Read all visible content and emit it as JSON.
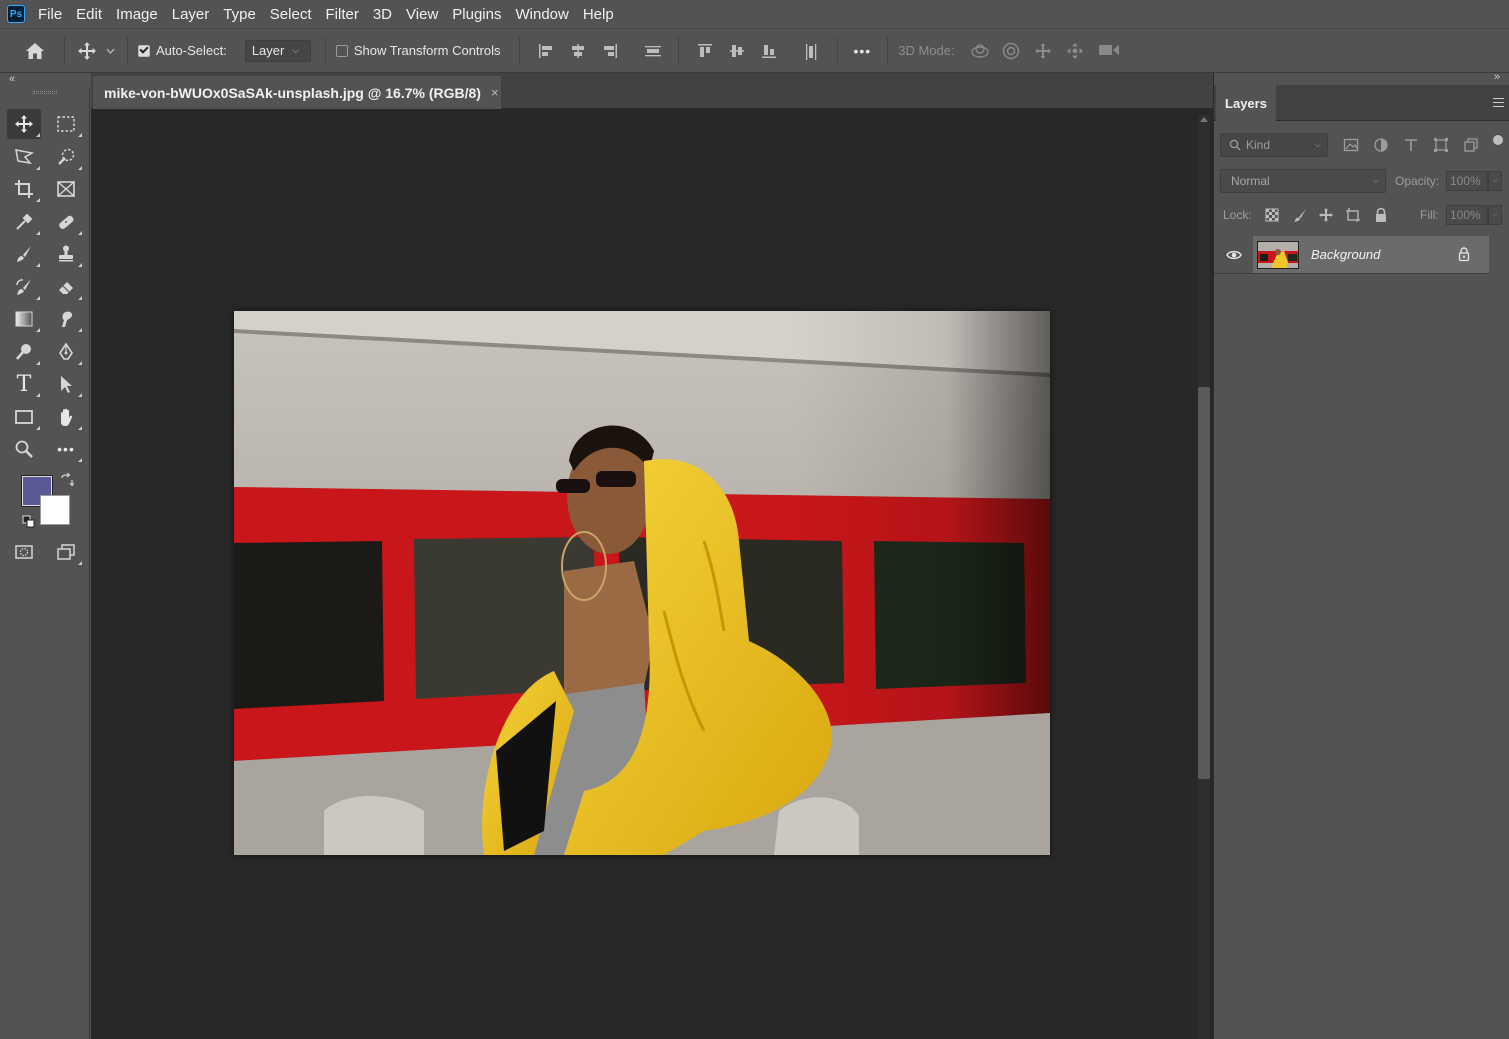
{
  "app": {
    "logo": "Ps",
    "menu": [
      "File",
      "Edit",
      "Image",
      "Layer",
      "Type",
      "Select",
      "Filter",
      "3D",
      "View",
      "Plugins",
      "Window",
      "Help"
    ]
  },
  "options_bar": {
    "auto_select_label": "Auto-Select:",
    "auto_select_checked": true,
    "auto_select_target": "Layer",
    "show_transform_label": "Show Transform Controls",
    "show_transform_checked": false,
    "more_label": "•••",
    "threed_mode_label": "3D Mode:"
  },
  "document": {
    "tab_title": "mike-von-bWUOx0SaSAk-unsplash.jpg @ 16.7% (RGB/8)",
    "close_glyph": "×"
  },
  "colors": {
    "foreground": "#5b5896",
    "background": "#ffffff",
    "accent": "#31a8ff"
  },
  "tools": {
    "more_glyph": "•••",
    "type_glyph": "T"
  },
  "layers_panel": {
    "tab_label": "Layers",
    "kind_placeholder": "Kind",
    "blend_mode": "Normal",
    "opacity_label": "Opacity:",
    "opacity_value": "100%",
    "lock_label": "Lock:",
    "fill_label": "Fill:",
    "fill_value": "100%",
    "layers": [
      {
        "name": "Background",
        "visible": true,
        "locked": true
      }
    ]
  },
  "collapse": {
    "left": "«",
    "right": "»",
    "right_panel": "»"
  }
}
